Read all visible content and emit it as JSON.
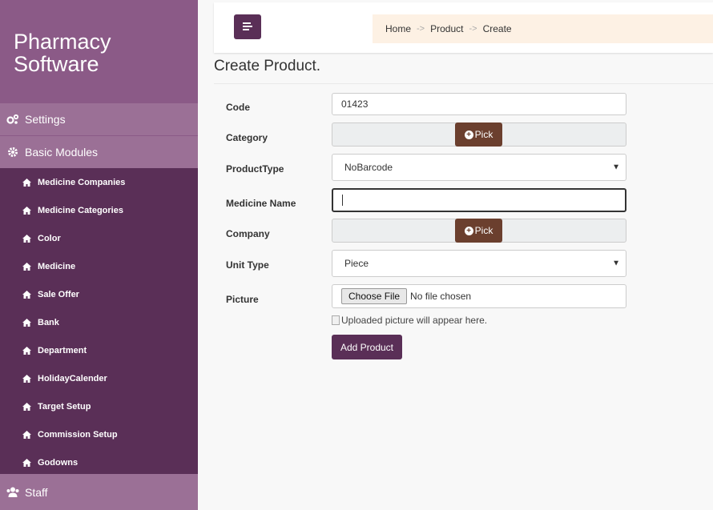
{
  "sidebar": {
    "brand_line1": "Pharmacy",
    "brand_line2": "Software",
    "settings": {
      "label": "Settings",
      "icon": "gears-icon"
    },
    "basic_modules": {
      "label": "Basic Modules",
      "icon": "gear-icon"
    },
    "items": [
      {
        "label": "Medicine Companies",
        "icon": "home-icon"
      },
      {
        "label": "Medicine Categories",
        "icon": "home-icon"
      },
      {
        "label": "Color",
        "icon": "home-icon"
      },
      {
        "label": "Medicine",
        "icon": "home-icon"
      },
      {
        "label": "Sale Offer",
        "icon": "home-icon"
      },
      {
        "label": "Bank",
        "icon": "home-icon"
      },
      {
        "label": "Department",
        "icon": "home-icon"
      },
      {
        "label": "HolidayCalender",
        "icon": "home-icon"
      },
      {
        "label": "Target Setup",
        "icon": "home-icon"
      },
      {
        "label": "Commission Setup",
        "icon": "home-icon"
      },
      {
        "label": "Godowns",
        "icon": "home-icon"
      }
    ],
    "staff": {
      "label": "Staff",
      "icon": "users-icon"
    }
  },
  "breadcrumb": {
    "home": "Home",
    "product": "Product",
    "create": "Create",
    "separator": "->"
  },
  "page_title": "Create Product.",
  "form": {
    "code": {
      "label": "Code",
      "value": "01423"
    },
    "category": {
      "label": "Category",
      "pick_label": "Pick"
    },
    "product_type": {
      "label": "ProductType",
      "value": "NoBarcode"
    },
    "medicine_name": {
      "label": "Medicine Name",
      "value": ""
    },
    "company": {
      "label": "Company",
      "pick_label": "Pick"
    },
    "unit_type": {
      "label": "Unit Type",
      "value": "Piece"
    },
    "picture": {
      "label": "Picture",
      "choose_label": "Choose File",
      "status": "No file chosen"
    },
    "preview_text": "Uploaded picture will appear here.",
    "submit_label": "Add Product"
  },
  "colors": {
    "sidebar": "#5a2f57",
    "brand": "#8b5a87",
    "section": "#9b7096",
    "pick": "#6b3f2e",
    "breadcrumb_bg": "#fdf1e4"
  }
}
